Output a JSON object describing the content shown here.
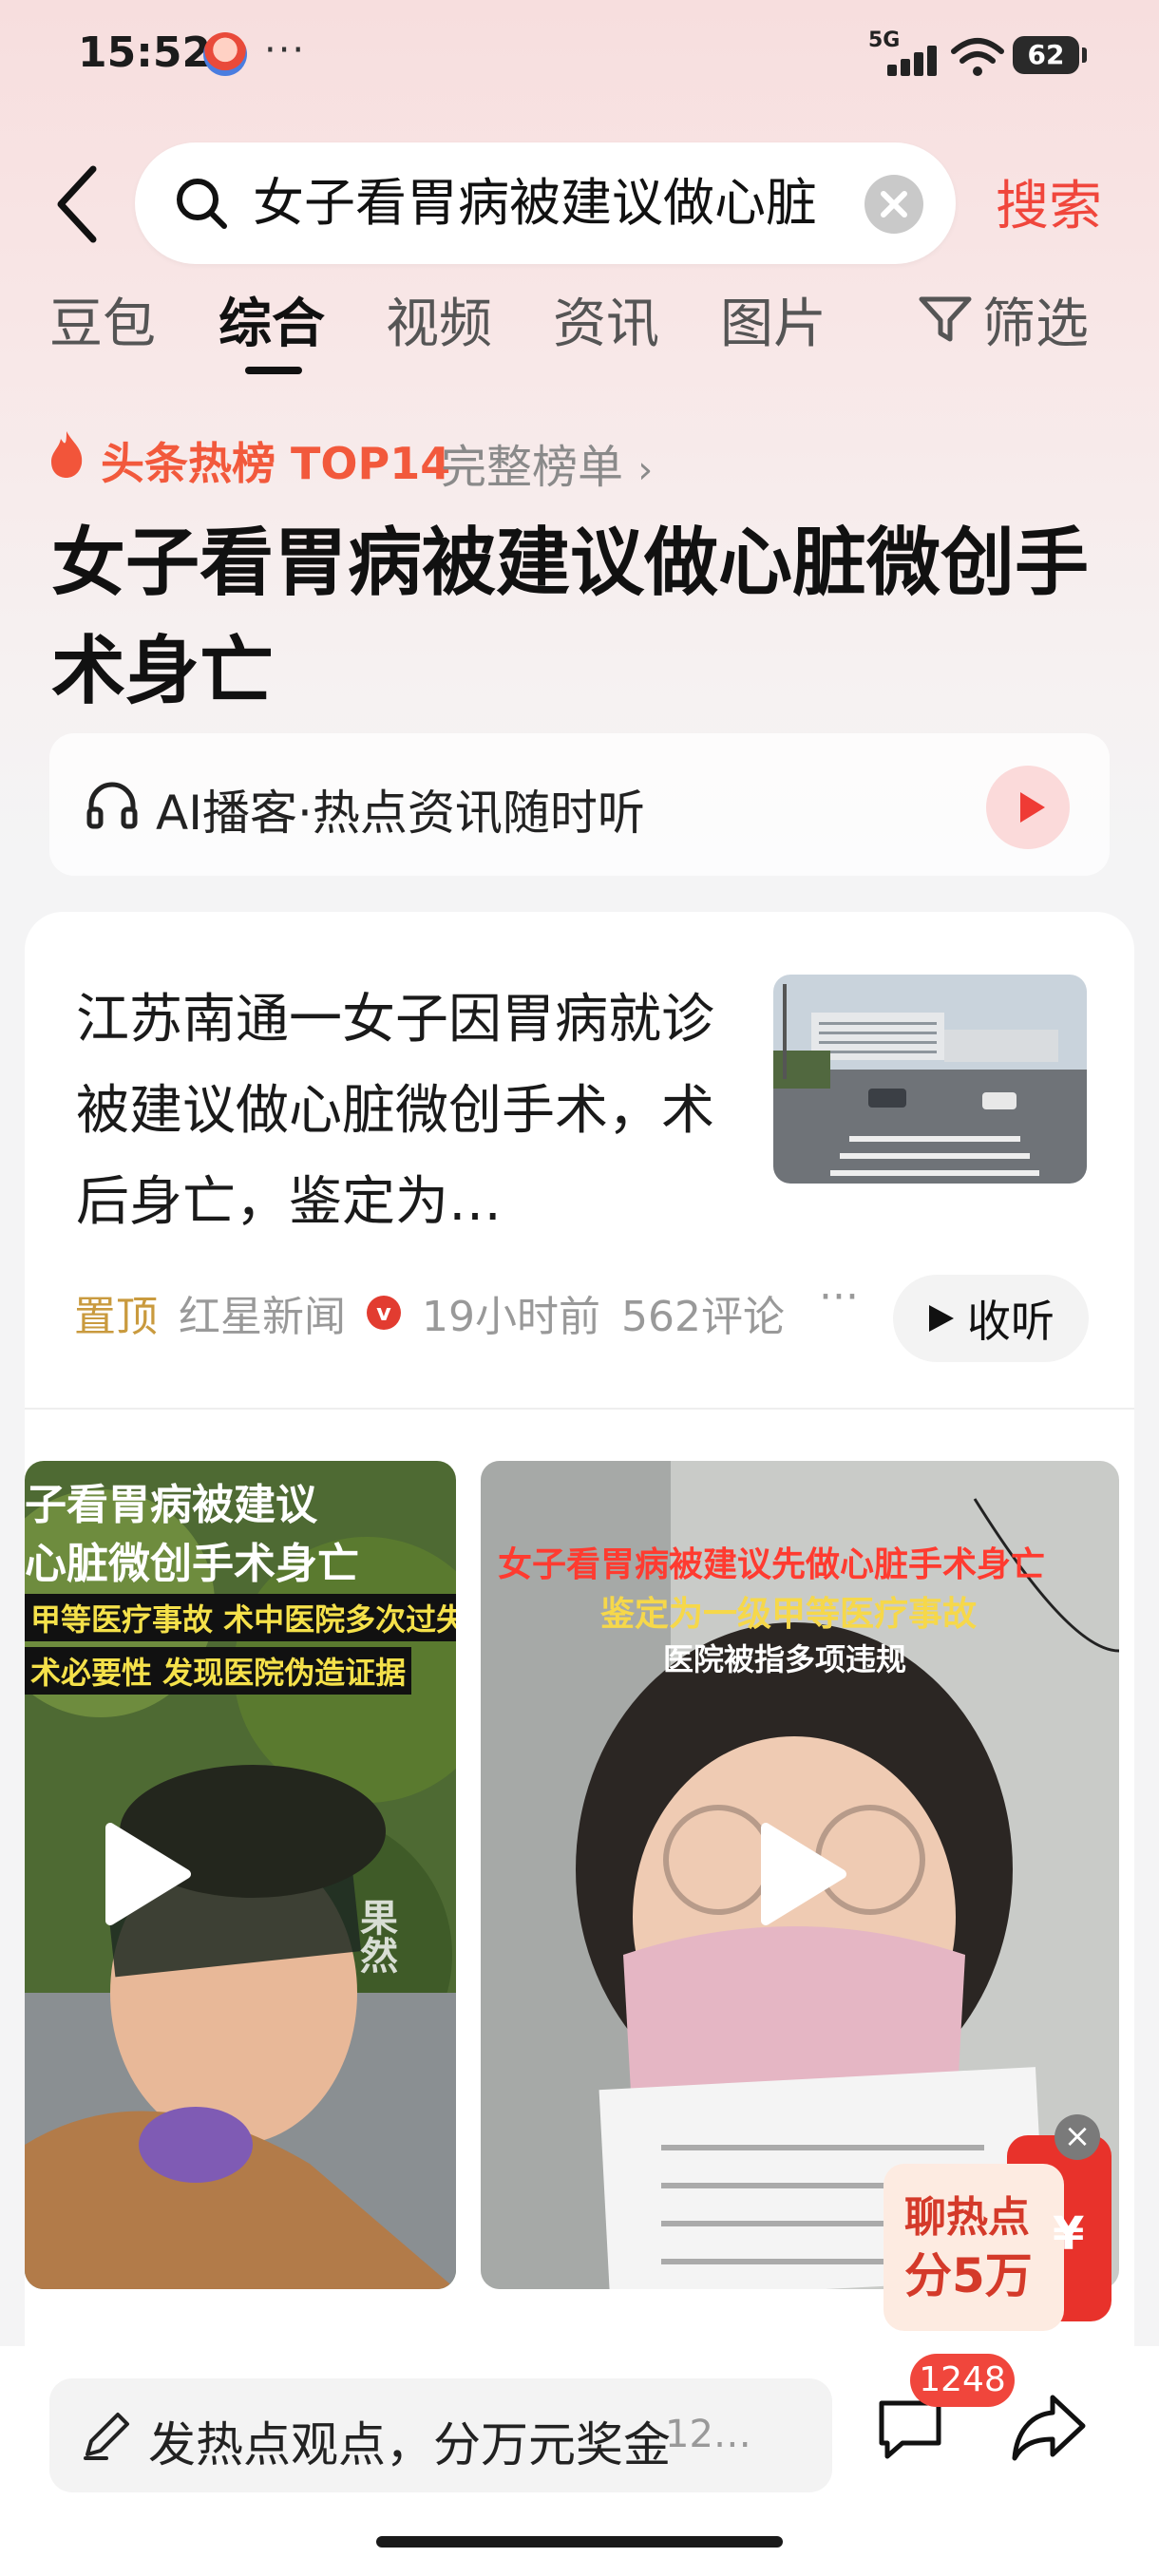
{
  "status_bar": {
    "time": "15:52",
    "dots": "···",
    "network": "5G",
    "battery": "62"
  },
  "search": {
    "query": "女子看胃病被建议做心脏",
    "button": "搜索"
  },
  "tabs": [
    {
      "label": "豆包"
    },
    {
      "label": "综合",
      "active": true
    },
    {
      "label": "视频"
    },
    {
      "label": "资讯"
    },
    {
      "label": "图片"
    }
  ],
  "filter_label": "筛选",
  "hot": {
    "rank_label": "头条热榜 TOP14",
    "full_list": "完整榜单"
  },
  "topic_title": "女子看胃病被建议做心脏微创手术身亡",
  "podcast": {
    "label": "AI播客·热点资讯随时听"
  },
  "article": {
    "headline": "江苏南通一女子因胃病就诊被建议做心脏微创手术，术后身亡，鉴定为…",
    "pin": "置顶",
    "source": "红星新闻",
    "verified": "v",
    "time": "19小时前",
    "comments": "562评论",
    "more": "···",
    "listen": "收听"
  },
  "videos": [
    {
      "captions": [
        "子看胃病被建议",
        "心脏微创手术身亡",
        "甲等医疗事故 术中医院多次过失",
        "术必要性 发现医院伪造证据"
      ],
      "watermark": "果然"
    },
    {
      "captions": [
        "女子看胃病被建议先做心脏手术身亡",
        "鉴定为一级甲等医疗事故",
        "医院被指多项违规"
      ]
    }
  ],
  "promo": {
    "line1": "聊热点",
    "line2": "分5万",
    "currency": "¥",
    "close": "×"
  },
  "bottom": {
    "comment_prompt": "发热点观点，分万元奖金",
    "comment_count": "12…",
    "badge": "1248"
  }
}
